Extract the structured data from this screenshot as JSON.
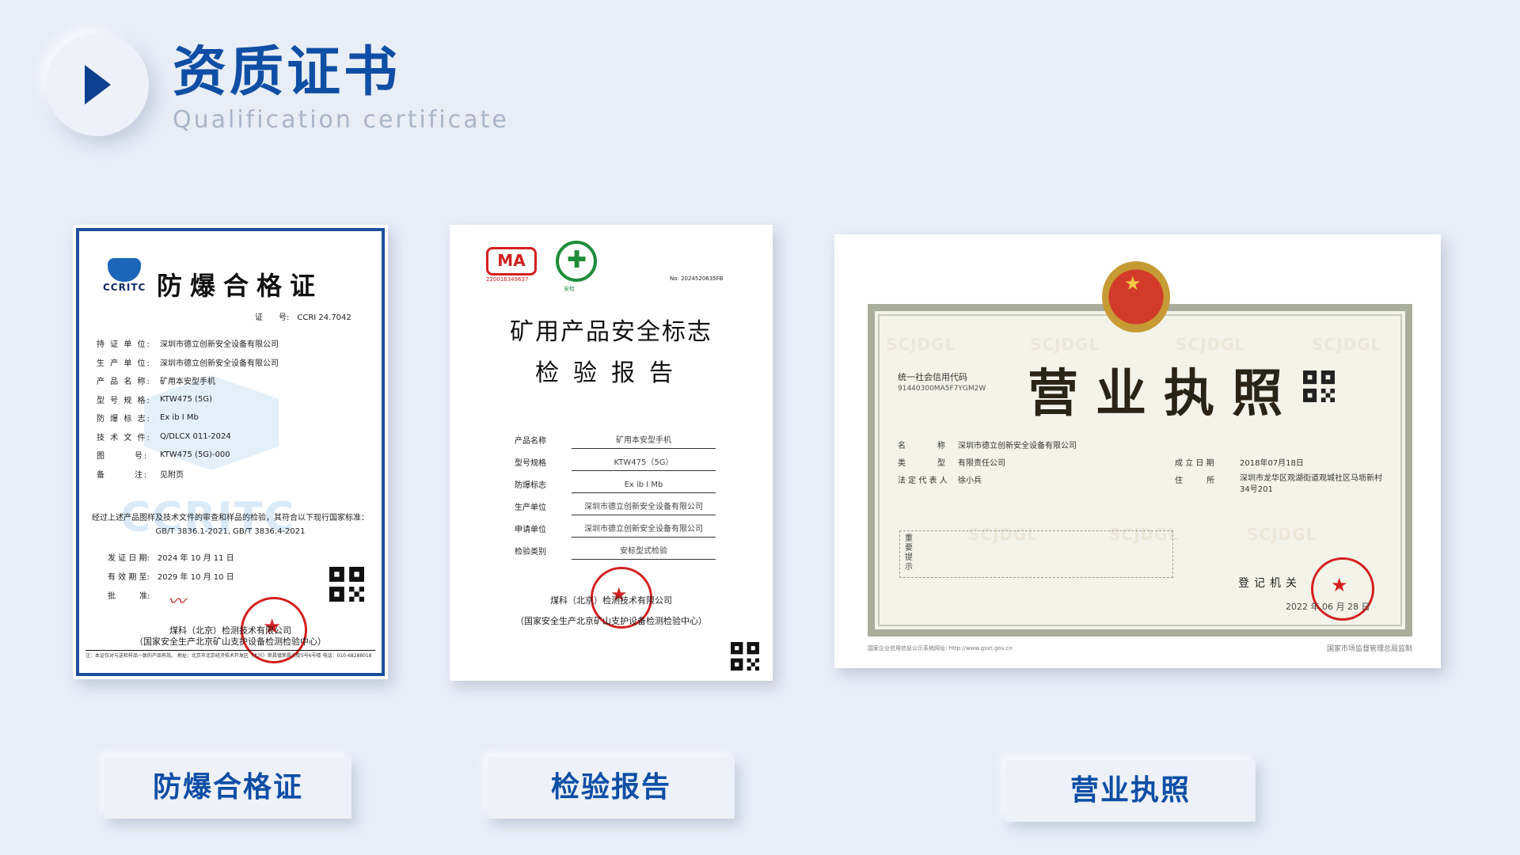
{
  "header": {
    "title": "资质证书",
    "subtitle": "Qualification certificate"
  },
  "cert1": {
    "logo_text": "CCRITC",
    "title": "防爆合格证",
    "cert_no": "证　　号:　CCRI 24.7042",
    "fields": [
      {
        "k": "持 证 单 位:",
        "v": "深圳市德立创新安全设备有限公司"
      },
      {
        "k": "生 产 单 位:",
        "v": "深圳市德立创新安全设备有限公司"
      },
      {
        "k": "产 品 名 称:",
        "v": "矿用本安型手机"
      },
      {
        "k": "型 号 规 格:",
        "v": "KTW475 (5G)"
      },
      {
        "k": "防 爆 标 志:",
        "v": "Ex ib I Mb"
      },
      {
        "k": "技 术 文 件:",
        "v": "Q/DLCX 011-2024"
      },
      {
        "k": "图　　　号:",
        "v": "KTW475 (5G)-000"
      },
      {
        "k": "备　　　注:",
        "v": "见附页"
      }
    ],
    "statement": "经过上述产品图样及技术文件的审查和样品的检验，其符合以下现行国家标准：",
    "standards": "GB/T 3836.1-2021, GB/T 3836.4-2021",
    "issue_date": "发 证 日 期:　2024 年 10 月 11 日",
    "valid_date": "有 效 期 至:　2029 年 10 月 10 日",
    "approve": "批　　　准:",
    "org": "煤科（北京）检测技术有限公司",
    "org_sub": "（国家安全生产北京矿山支护设备检测检验中心）",
    "footer": "注：本证仅对与送检样品一致的产品有效。 地址：北京市北京经济技术开发区（大兴）荣昌镇荣昌大街5号6号楼 电话：010-68288018"
  },
  "cert2": {
    "ma_logo": "MA",
    "ma_number": "220016349637",
    "safety_label": "安检",
    "report_no": "No: 2024520635FB",
    "title": "矿用产品安全标志",
    "title2": "检验报告",
    "fields": [
      {
        "k": "产品名称",
        "v": "矿用本安型手机"
      },
      {
        "k": "型号规格",
        "v": "KTW475（5G）"
      },
      {
        "k": "防爆标志",
        "v": "Ex ib I Mb"
      },
      {
        "k": "生产单位",
        "v": "深圳市德立创新安全设备有限公司"
      },
      {
        "k": "申请单位",
        "v": "深圳市德立创新安全设备有限公司"
      },
      {
        "k": "检验类别",
        "v": "安标型式检验"
      }
    ],
    "org": "煤科（北京）检测技术有限公司",
    "org_sub": "（国家安全生产北京矿山支护设备检测检验中心）"
  },
  "cert3": {
    "watermark": "SCJDGL",
    "title": "营业执照",
    "code_label": "统一社会信用代码",
    "code_value": "91440300MA5F7YGM2W",
    "name_k": "名　　　　称",
    "name_v": "深圳市德立创新安全设备有限公司",
    "type_k": "类　　　　型",
    "type_v": "有限责任公司",
    "rep_k": "法 定 代 表 人",
    "rep_v": "徐小兵",
    "date_k": "成 立 日 期",
    "date_v": "2018年07月18日",
    "addr_k": "住　　　所",
    "addr_v": "深圳市龙华区观湖街道观城社区马坜新村34号201",
    "notice_label": "重要提示",
    "authority": "登记机关",
    "issue_date": "2022 年 06 月 28 日",
    "footer_left": "国家企业信用信息公示系统网址: http://www.gsxt.gov.cn",
    "footer_right": "国家市场监督管理总局监制"
  },
  "labels": {
    "cert1": "防爆合格证",
    "cert2": "检验报告",
    "cert3": "营业执照"
  },
  "colors": {
    "accent": "#0e4ea5",
    "background": "#e9edf6",
    "seal": "#d32020"
  }
}
